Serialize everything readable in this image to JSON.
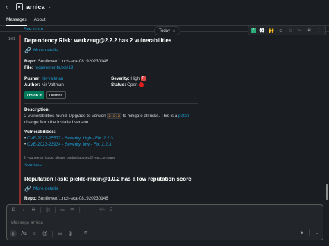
{
  "header": {
    "back_icon": "chevron-left-icon",
    "channel_name": "arnica",
    "channel_icon": "app-icon"
  },
  "tabs": [
    {
      "label": "Messages",
      "active": true
    },
    {
      "label": "About",
      "active": false
    }
  ],
  "feed": {
    "see_more_top": "See more",
    "date_label": "Today",
    "message_time": "1:01",
    "actions": [
      "check-icon",
      "eyes-icon",
      "raised-hands-icon",
      "add-reaction-icon",
      "reply-thread-icon",
      "forward-icon",
      "bookmark-icon",
      "more-icon"
    ],
    "card1": {
      "title": "Dependency Risk: werkzeug@2.2.2 has 2 vulnerabilities",
      "more_details": "More details",
      "repo_label": "Repo:",
      "repo_value": "Sunflower/...nch-sca-081920230146",
      "file_label": "File:",
      "file_value": "requirements.txt#19",
      "pusher_label": "Pusher:",
      "pusher_value": "nir-valtman",
      "author_label": "Author:",
      "author_value": "Nir Valtman",
      "severity_label": "Severity:",
      "severity_value": "High",
      "severity_badge": "P",
      "status_label": "Status:",
      "status_value": "Open",
      "btn_on_it": "I'm on it",
      "btn_dismiss": "Dismiss",
      "description_label": "Description:",
      "desc_part1": "2 vulnerabilities found. Upgrade to version",
      "desc_version": "2.2.3",
      "desc_part2": "to mitigate all risks. This is a",
      "desc_patch": "patch",
      "desc_part3": "change from the installed version.",
      "vulnerabilities_label": "Vulnerabilities:",
      "vulns": [
        "CVE-2023-25577 - Severity: high - Fix: 2.2.3",
        "CVE-2023-23934 - Severity: low - Fix: 2.2.3"
      ],
      "note": "If you see an issue, please contact appsec@your.company.",
      "see_less": "See less"
    },
    "card2": {
      "title": "Reputation Risk: pickle-mixin@1.0.2 has a low reputation score",
      "more_details": "More details",
      "repo_label": "Repo:",
      "repo_value": "Sunflower/...nch-sca-081920230146"
    }
  },
  "composer": {
    "placeholder": "Message arnica",
    "format_tools": [
      "B",
      "I",
      "S",
      "link-icon",
      "ordered-list-icon",
      "bullet-list-icon",
      "quote-icon",
      "code-icon",
      "code-block-icon"
    ],
    "bottom_tools": [
      "plus-icon",
      "text-format-icon",
      "emoji-icon",
      "mention-icon",
      "video-icon",
      "audio-icon",
      "shortcut-icon"
    ],
    "send_tools": [
      "send-icon",
      "schedule-icon"
    ]
  },
  "colors": {
    "accent_link": "#1d9bd1",
    "danger": "#8b2e2e",
    "green": "#007a5a"
  }
}
